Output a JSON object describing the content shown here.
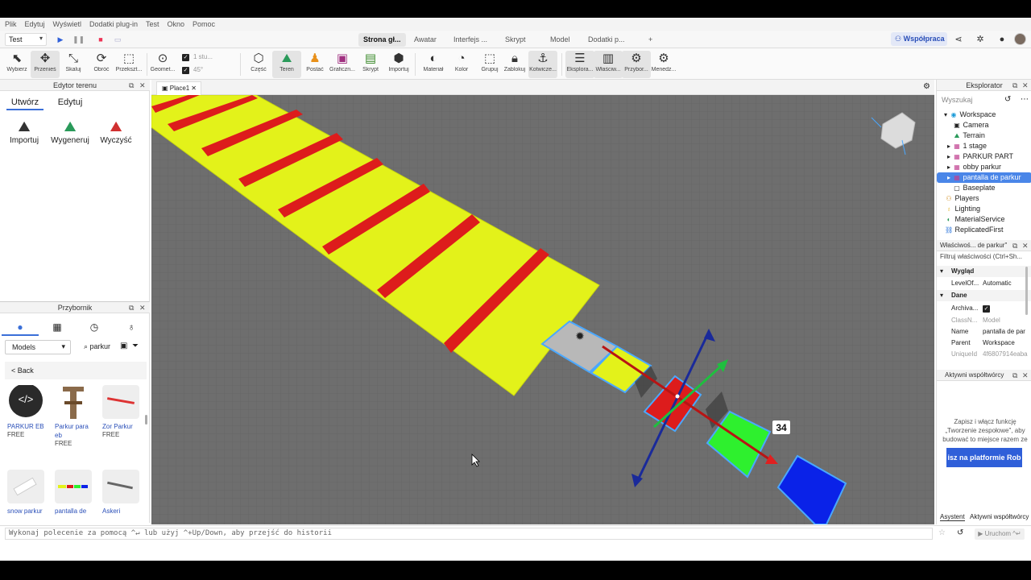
{
  "menu": [
    "Plik",
    "Edytuj",
    "Wyświetl",
    "Dodatki plug-in",
    "Test",
    "Okno",
    "Pomoc"
  ],
  "topbar": {
    "mode_select": "Test",
    "ribbon_tabs": [
      "Strona gł...",
      "Awatar",
      "Interfejs ...",
      "Skrypt",
      "Model",
      "Dodatki p...",
      "+"
    ],
    "active_tab_index": 0,
    "collab_button": "Współpraca"
  },
  "toolbar": {
    "tools": [
      "Wybierz",
      "Przenieś",
      "Skaluj",
      "Obróć",
      "Przekszt...",
      "Geomet...",
      "Część",
      "Teren",
      "Postać",
      "Graficzn...",
      "Skrypt",
      "Importuj",
      "Materiał",
      "Kolor",
      "Grupuj",
      "Zablokuj",
      "Kotwicze...",
      "Eksplora...",
      "Właściw...",
      "Przybor...",
      "Menedż..."
    ],
    "snap_move": "1 stu...",
    "snap_rotate": "45°"
  },
  "terrain_editor": {
    "title": "Edytor terenu",
    "tabs": [
      "Utwórz",
      "Edytuj"
    ],
    "buttons": [
      "Importuj",
      "Wygeneruj",
      "Wyczyść"
    ]
  },
  "toolbox": {
    "title": "Przybornik",
    "category": "Models",
    "search_value": "parkur",
    "back_label": "< Back",
    "models": [
      {
        "name": "PARKUR EB",
        "price": "FREE"
      },
      {
        "name": "Parkur para eb",
        "price": "FREE"
      },
      {
        "name": "Zor Parkur",
        "price": "FREE"
      },
      {
        "name": "snow parkur",
        "price": ""
      },
      {
        "name": "pantalla de",
        "price": ""
      },
      {
        "name": "Askeri",
        "price": ""
      }
    ]
  },
  "viewport": {
    "tab_label": "Place1",
    "scale_label": "34"
  },
  "explorer": {
    "title": "Eksplorator",
    "search_placeholder": "Wyszukaj",
    "items": [
      "Workspace",
      "Camera",
      "Terrain",
      "1 stage",
      "PARKUR PART",
      "obby parkur",
      "pantalla de parkur",
      "Baseplate",
      "Players",
      "Lighting",
      "MaterialService",
      "ReplicatedFirst"
    ]
  },
  "properties": {
    "title": "Właściwoś... de parkur\"",
    "filter_placeholder": "Filtruj właściwości (Ctrl+Sh...",
    "categories": [
      "Wygląd",
      "Dane"
    ],
    "rows": [
      {
        "key": "LevelOf...",
        "value": "Automatic"
      },
      {
        "key": "Archiva...",
        "value": ""
      },
      {
        "key": "ClassN...",
        "value": "Model"
      },
      {
        "key": "Name",
        "value": "pantalla de par"
      },
      {
        "key": "Parent",
        "value": "Workspace"
      },
      {
        "key": "UniqueId",
        "value": "4f6807914eaba"
      }
    ]
  },
  "collaborators": {
    "title": "Aktywni współtwórcy",
    "message": "Zapisz i włącz funkcję „Tworzenie zespołowe\", aby budować to miejsce razem ze",
    "cta": "isz na platformie Rob",
    "bottom_tabs": [
      "Asystent",
      "Aktywni współtwórcy"
    ]
  },
  "command_bar": {
    "placeholder": "Wykonaj polecenie za pomocą ^↵ lub użyj ^+Up/Down, aby przejść do historii",
    "run_label": "Uruchom ^↵"
  },
  "colors": {
    "platform_yellow": "#e3f21a",
    "stripe_red": "#dd1c1c",
    "part_green": "#2ef02e",
    "part_blue": "#0a22e8",
    "accent": "#3a6fd8"
  }
}
